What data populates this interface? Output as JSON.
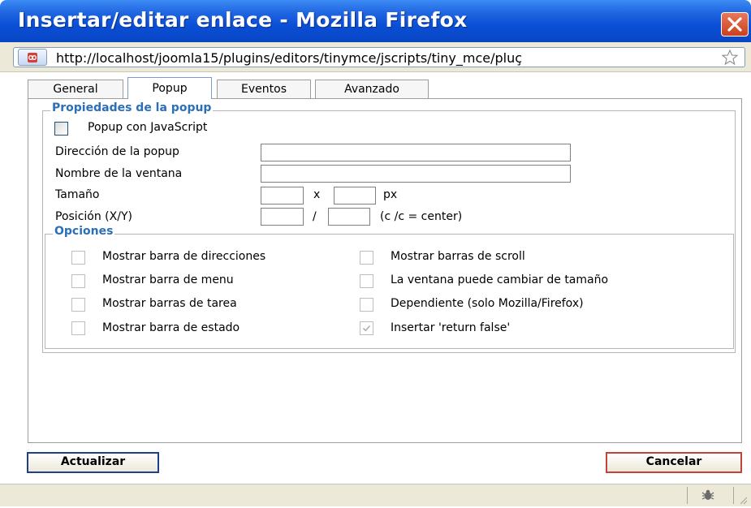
{
  "window": {
    "title": "Insertar/editar enlace - Mozilla Firefox",
    "close_icon": "close-icon"
  },
  "urlbar": {
    "url": "http://localhost/joomla15/plugins/editors/tinymce/jscripts/tiny_mce/pluç",
    "site_icon": "site-identity-icon",
    "star_icon": "bookmark-star-icon"
  },
  "tabs": [
    {
      "label": "General"
    },
    {
      "label": "Popup",
      "active": true
    },
    {
      "label": "Eventos"
    },
    {
      "label": "Avanzado"
    }
  ],
  "popup_props": {
    "legend": "Propiedades de la popup",
    "js_popup_label": "Popup con JavaScript",
    "url_label": "Dirección de la popup",
    "url_value": "",
    "name_label": "Nombre de la ventana",
    "name_value": "",
    "size_label": "Tamaño",
    "size_x": "x",
    "size_unit": "px",
    "width_value": "",
    "height_value": "",
    "position_label": "Posición (X/Y)",
    "position_sep": "/",
    "position_hint": "(c /c = center)",
    "left_value": "",
    "top_value": ""
  },
  "options": {
    "legend": "Opciones",
    "left": [
      {
        "label": "Mostrar barra de direcciones",
        "checked": false
      },
      {
        "label": "Mostrar barra de menu",
        "checked": false
      },
      {
        "label": "Mostrar barras de tarea",
        "checked": false
      },
      {
        "label": "Mostrar barra de estado",
        "checked": false
      }
    ],
    "right": [
      {
        "label": "Mostrar barras de scroll",
        "checked": false
      },
      {
        "label": "La ventana puede cambiar de tamaño",
        "checked": false
      },
      {
        "label": "Dependiente (solo Mozilla/Firefox)",
        "checked": false
      },
      {
        "label": "Insertar 'return false'",
        "checked": true
      }
    ]
  },
  "buttons": {
    "update": "Actualizar",
    "cancel": "Cancelar"
  },
  "statusbar": {
    "bug_icon": "firebug-icon",
    "grip_icon": "resize-grip-icon"
  }
}
